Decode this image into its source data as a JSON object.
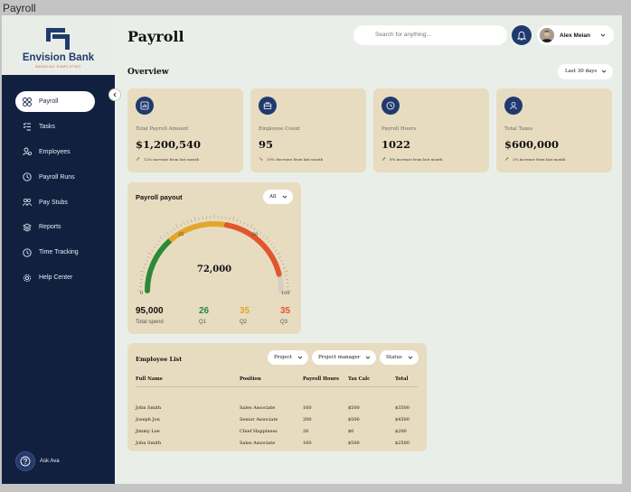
{
  "window": {
    "title": "Payroll"
  },
  "brand": {
    "name": "Envision Bank",
    "tagline": "BANKING SIMPLIFIED"
  },
  "sidebar": {
    "items": [
      {
        "label": "Payroll",
        "icon": "grid-icon",
        "active": true
      },
      {
        "label": "Tasks",
        "icon": "checklist-icon"
      },
      {
        "label": "Employees",
        "icon": "employees-icon"
      },
      {
        "label": "Payroll Runs",
        "icon": "clock-icon"
      },
      {
        "label": "Pay Stubs",
        "icon": "pay-stubs-icon"
      },
      {
        "label": "Reports",
        "icon": "stack-icon"
      },
      {
        "label": "Time Tracking",
        "icon": "clock-icon"
      },
      {
        "label": "Help Center",
        "icon": "gear-icon"
      }
    ],
    "ask_label": "Ask Ava"
  },
  "header": {
    "title": "Payroll",
    "search_placeholder": "Search for anything...",
    "user_name": "Alex Meian"
  },
  "overview": {
    "title": "Overview",
    "range": "Last 30 days",
    "stats": [
      {
        "label": "Total Payroll Amount",
        "value": "$1,200,540",
        "change": "12% increase from last month",
        "direction": "up"
      },
      {
        "label": "Employee Count",
        "value": "95",
        "change": "10% decrease from last month",
        "direction": "down"
      },
      {
        "label": "Payroll Hours",
        "value": "1022",
        "change": "8% increase from last month",
        "direction": "up"
      },
      {
        "label": "Total Taxes",
        "value": "$600,000",
        "change": "2% increase from last month",
        "direction": "up"
      }
    ]
  },
  "payout": {
    "title": "Payroll payout",
    "filter": "All",
    "gauge_value": "72,000",
    "gauge_ticks": [
      "0",
      "25",
      "50",
      "100"
    ],
    "gauge_level_percent": 72,
    "total": "95,000",
    "total_label": "Total spend",
    "quarters": [
      {
        "value": "26",
        "label": "Q1",
        "color": "#2a8a37"
      },
      {
        "value": "35",
        "label": "Q2",
        "color": "#e3a62b"
      },
      {
        "value": "35",
        "label": "Q3",
        "color": "#e2552d"
      }
    ]
  },
  "employees": {
    "title": "Employee List",
    "filters": [
      "Project",
      "Project manager",
      "Status"
    ],
    "columns": [
      "Full Name",
      "Position",
      "Payroll Hours",
      "Tax Calc",
      "Total"
    ],
    "rows": [
      [
        "John Smith",
        "Sales Associate",
        "160",
        "$500",
        "$3500"
      ],
      [
        "Joseph Jon",
        "Senior Associate",
        "200",
        "$500",
        "$4500"
      ],
      [
        "Jimmy Lee",
        "Chief Happiness",
        "20",
        "$0",
        "$200"
      ],
      [
        "John Smith",
        "Sales Associate",
        "160",
        "$500",
        "$2500"
      ]
    ]
  },
  "colors": {
    "sidebar_bg": "#122040",
    "card_bg": "#e8dcc0",
    "accent": "#1f3b6e",
    "page_bg": "#e9efe8"
  }
}
